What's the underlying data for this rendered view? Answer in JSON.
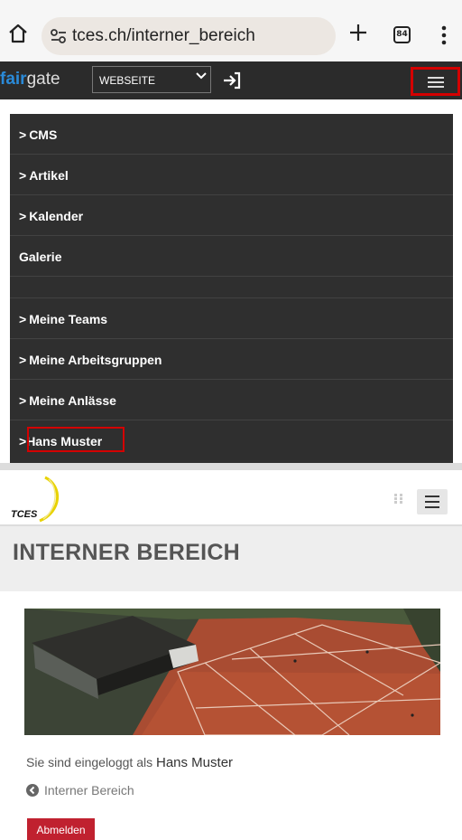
{
  "browser": {
    "url": "tces.ch/interner_bereich",
    "tab_count": "84",
    "icons": [
      "home-icon",
      "site-settings-icon",
      "new-tab-icon",
      "tab-switcher-icon",
      "more-options-icon"
    ]
  },
  "fairgate": {
    "logo_part1": "fair",
    "logo_part2": "gate",
    "website_select": "WEBSEITE",
    "colors": {
      "bar": "#2b2b2b",
      "logo_accent": "#2a8ad8",
      "highlight": "#d40000"
    }
  },
  "menu": {
    "items": [
      {
        "label": "CMS",
        "arrow": ">"
      },
      {
        "label": "Artikel",
        "arrow": ">"
      },
      {
        "label": "Kalender",
        "arrow": ">"
      },
      {
        "label": "Galerie",
        "arrow": ""
      },
      {
        "label": "",
        "arrow": ""
      },
      {
        "label": "Meine Teams",
        "arrow": ">"
      },
      {
        "label": "Meine Arbeitsgruppen",
        "arrow": ">"
      },
      {
        "label": "Meine Anlässe",
        "arrow": ">"
      },
      {
        "label": "Hans Muster",
        "arrow": ">"
      }
    ]
  },
  "site": {
    "logo_text": "TCES",
    "page_title": "INTERNER BEREICH",
    "logged_in_prefix": "Sie sind eingeloggt als",
    "user_name": "Hans Muster",
    "back_link": "Interner Bereich",
    "logout_button": "Abmelden",
    "colors": {
      "logout": "#c0212f",
      "logo_arc": "#e8d200"
    }
  }
}
